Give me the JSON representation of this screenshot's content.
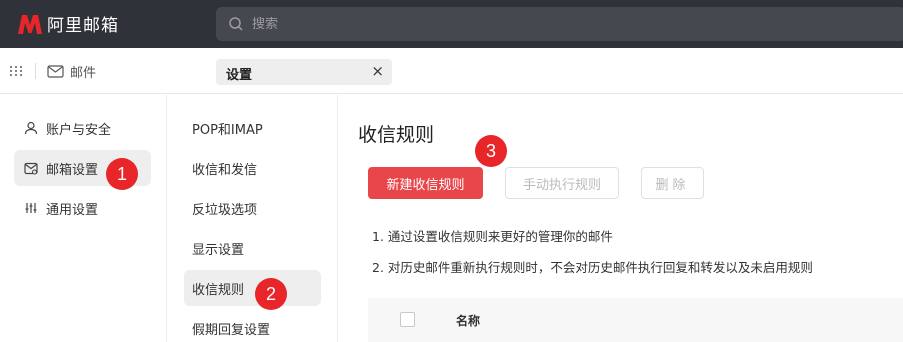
{
  "app": {
    "name": "阿里邮箱",
    "brand_color": "#e8262a"
  },
  "search": {
    "placeholder": "搜索"
  },
  "tabs": {
    "mail_label": "邮件",
    "settings_label": "设置",
    "close_glyph": "×"
  },
  "sidebar": {
    "items": [
      {
        "label": "账户与安全",
        "icon": "user-icon"
      },
      {
        "label": "邮箱设置",
        "icon": "mailbox-settings-icon",
        "active": true
      },
      {
        "label": "通用设置",
        "icon": "sliders-icon"
      }
    ]
  },
  "submenu": {
    "items": [
      {
        "label": "POP和IMAP"
      },
      {
        "label": "收信和发信"
      },
      {
        "label": "反垃圾选项"
      },
      {
        "label": "显示设置"
      },
      {
        "label": "收信规则",
        "active": true
      },
      {
        "label": "假期回复设置"
      }
    ]
  },
  "main": {
    "title": "收信规则",
    "new_rule_button": "新建收信规则",
    "run_rule_button": "手动执行规则",
    "delete_button": "删除",
    "tips": [
      "1. 通过设置收信规则来更好的管理你的邮件",
      "2. 对历史邮件重新执行规则时，不会对历史邮件执行回复和转发以及未启用规则"
    ],
    "table": {
      "col_name": "名称"
    }
  },
  "annotations": {
    "step1": "1",
    "step2": "2",
    "step3": "3"
  }
}
